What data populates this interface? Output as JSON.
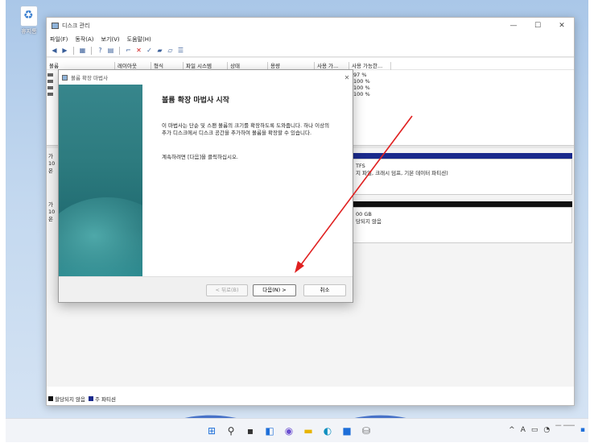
{
  "desktop": {
    "icon_label": "휴지통"
  },
  "window": {
    "title": "디스크 관리",
    "controls": [
      "—",
      "☐",
      "✕"
    ],
    "menu": [
      "파일(F)",
      "동작(A)",
      "보기(V)",
      "도움말(H)"
    ],
    "columns": [
      "볼륨",
      "레이아웃",
      "형식",
      "파일 시스템",
      "상태",
      "용량",
      "사용 가...",
      "사용 가능한..."
    ],
    "percents": [
      "97 %",
      "100 %",
      "100 %",
      "100 %"
    ],
    "disks": [
      {
        "label_lines": [
          "가",
          "10",
          "온"
        ],
        "lines": [
          "TFS",
          "지 파일, 크래시 덤프, 기본 데이터 파티션)"
        ]
      },
      {
        "label_lines": [
          "가",
          "10",
          "온"
        ],
        "lines": [
          "00 GB",
          "당되지 않음"
        ]
      }
    ],
    "legend": [
      {
        "label": "할당되지 않음",
        "color": "#111111"
      },
      {
        "label": "주 파티션",
        "color": "#1a2a8c"
      }
    ]
  },
  "dialog": {
    "title": "볼륨 확장 마법사",
    "close": "✕",
    "heading": "볼륨 확장 마법사 시작",
    "paragraph": "이 마법사는 단순 및 스팬 볼륨의 크기를 확장하도록 도와줍니다. 하나 이상의 추가 디스크에서 디스크 공간을 추가하여 볼륨을 확장할 수 있습니다.",
    "continue": "계속하려면 [다음]을 클릭하십시오.",
    "back_button": "< 뒤로(B)",
    "next_button": "다음(N) >",
    "cancel_button": "취소"
  },
  "colors": {
    "partition_bar": "#1a2a8c",
    "unallocated_bar": "#111111",
    "arrow": "#e02020"
  },
  "taskbar": {
    "tray_text": "A"
  }
}
